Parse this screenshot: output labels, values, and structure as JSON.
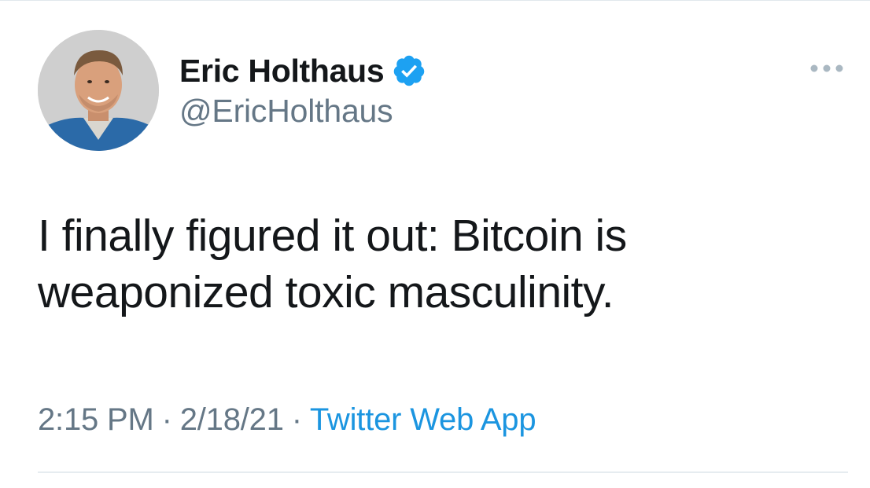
{
  "author": {
    "name": "Eric Holthaus",
    "handle": "@EricHolthaus",
    "verified": true,
    "verified_color": "#1da1f2"
  },
  "tweet": {
    "text_lines": [
      "I finally figured it out: Bitcoin is",
      "weaponized toxic masculinity."
    ]
  },
  "meta": {
    "time": "2:15 PM",
    "separator": "·",
    "date": "2/18/21",
    "source": "Twitter Web App",
    "source_color": "#1b95e0"
  },
  "icons": {
    "more": "more-horizontal-icon",
    "verified": "verified-badge-icon",
    "avatar": "profile-photo"
  }
}
